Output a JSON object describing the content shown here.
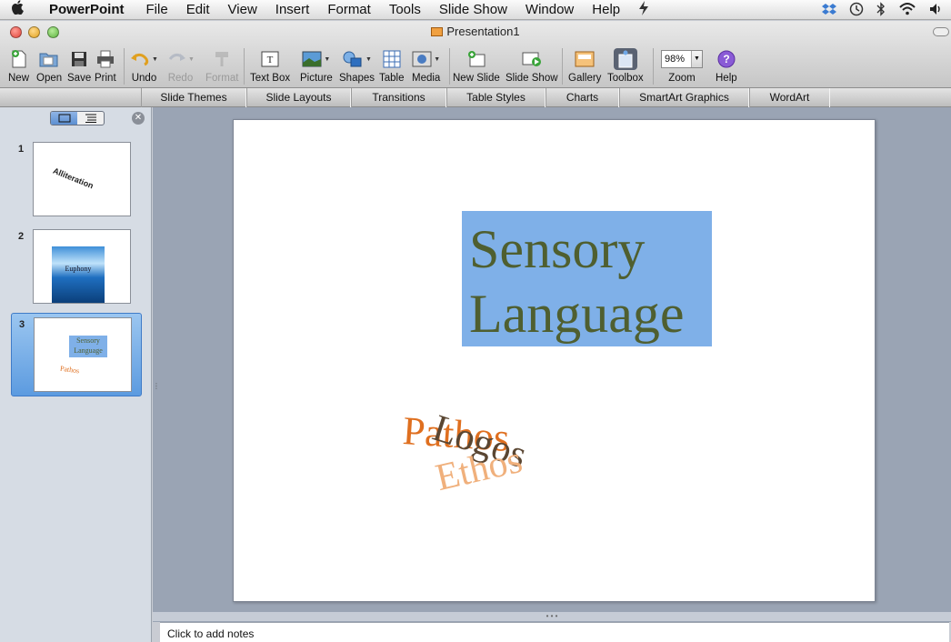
{
  "menubar": {
    "app_name": "PowerPoint",
    "items": [
      "File",
      "Edit",
      "View",
      "Insert",
      "Format",
      "Tools",
      "Slide Show",
      "Window",
      "Help"
    ]
  },
  "window": {
    "title": "Presentation1"
  },
  "toolbar": {
    "new": "New",
    "open": "Open",
    "save": "Save",
    "print": "Print",
    "undo": "Undo",
    "redo": "Redo",
    "format": "Format",
    "text_box": "Text Box",
    "picture": "Picture",
    "shapes": "Shapes",
    "table": "Table",
    "media": "Media",
    "new_slide": "New Slide",
    "slide_show": "Slide Show",
    "gallery": "Gallery",
    "toolbox": "Toolbox",
    "zoom_value": "98%",
    "zoom": "Zoom",
    "help": "Help"
  },
  "ribbon": {
    "tabs": [
      "Slide Themes",
      "Slide Layouts",
      "Transitions",
      "Table Styles",
      "Charts",
      "SmartArt Graphics",
      "WordArt"
    ]
  },
  "slides": [
    {
      "number": "1",
      "thumb_text": "Alliteration"
    },
    {
      "number": "2",
      "thumb_text": "Euphony"
    },
    {
      "number": "3",
      "thumb_title_1": "Sensory",
      "thumb_title_2": "Language",
      "thumb_art": "Pathos"
    }
  ],
  "current_slide": {
    "title_line_1": "Sensory",
    "title_line_2": "Language",
    "wordart": {
      "pathos": "Pathos",
      "logos": "Logos",
      "ethos": "Ethos"
    }
  },
  "notes": {
    "placeholder": "Click to add notes"
  },
  "colors": {
    "title_box": "#7fb0e8",
    "title_text": "#4f5f30",
    "pathos": "#df6f1f",
    "logos": "#5a4632",
    "ethos": "#f0b07c",
    "selected_thumb": "#5c9be0"
  }
}
